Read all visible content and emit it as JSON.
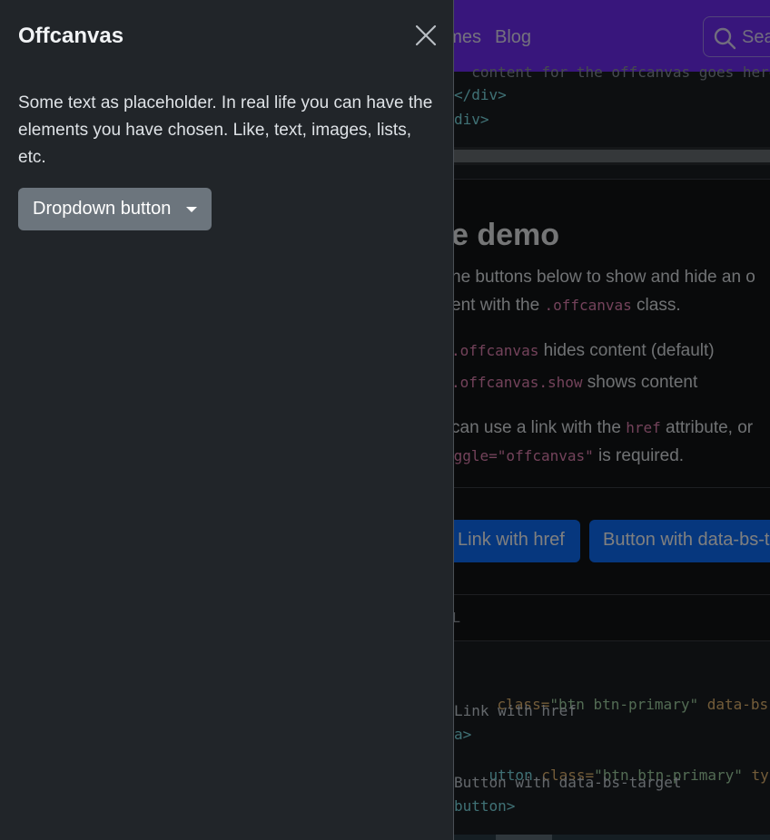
{
  "background": {
    "nav": {
      "links": [
        "hemes",
        "Blog"
      ],
      "search_placeholder": "Sea"
    },
    "code_top": [
      "  content for the offcanvas goes here",
      "</div>",
      "div>"
    ],
    "section": {
      "heading": "e demo",
      "para1_line1": "he buttons below to show and hide an o",
      "para1_line2_pre": "ent with the ",
      "para1_line2_code": ".offcanvas",
      "para1_line2_post": " class.",
      "bullet1_code": ".offcanvas",
      "bullet1_text": " hides content (default)",
      "bullet2_code": ".offcanvas.show",
      "bullet2_text": " shows content",
      "para2_line1_pre": "can use a link with the ",
      "para2_line1_code": "href",
      "para2_line1_post": " attribute, or",
      "para2_line2_code": "oggle=\"offcanvas\"",
      "para2_line2_post": " is required."
    },
    "buttons": {
      "link": "Link with href",
      "button": "Button with data-bs-target"
    },
    "html_label": "ML",
    "code_bottom": {
      "l1_attr1": "class=",
      "l1_str1": "\"btn btn-primary\"",
      "l1_attr2": "data-bs-togg",
      "l2": "Link with href",
      "l3": "a>",
      "l4_tag": "utton",
      "l4_attr1": "class=",
      "l4_str1": "\"btn btn-primary\"",
      "l4_attr2": "type=",
      "l4_str2": "\"",
      "l5": "Button with data-bs-target",
      "l6": "button>"
    }
  },
  "offcanvas": {
    "title": "Offcanvas",
    "body_text": "Some text as placeholder. In real life you can have the elements you have chosen. Like, text, images, lists, etc.",
    "dropdown_label": "Dropdown button"
  },
  "colors": {
    "nav": "#712cf9",
    "panel": "#212529",
    "dropdown": "#6c757d",
    "primary": "#0d6efd"
  },
  "icons": {
    "close": "close-icon",
    "search": "search-icon",
    "caret": "caret-down-icon"
  }
}
